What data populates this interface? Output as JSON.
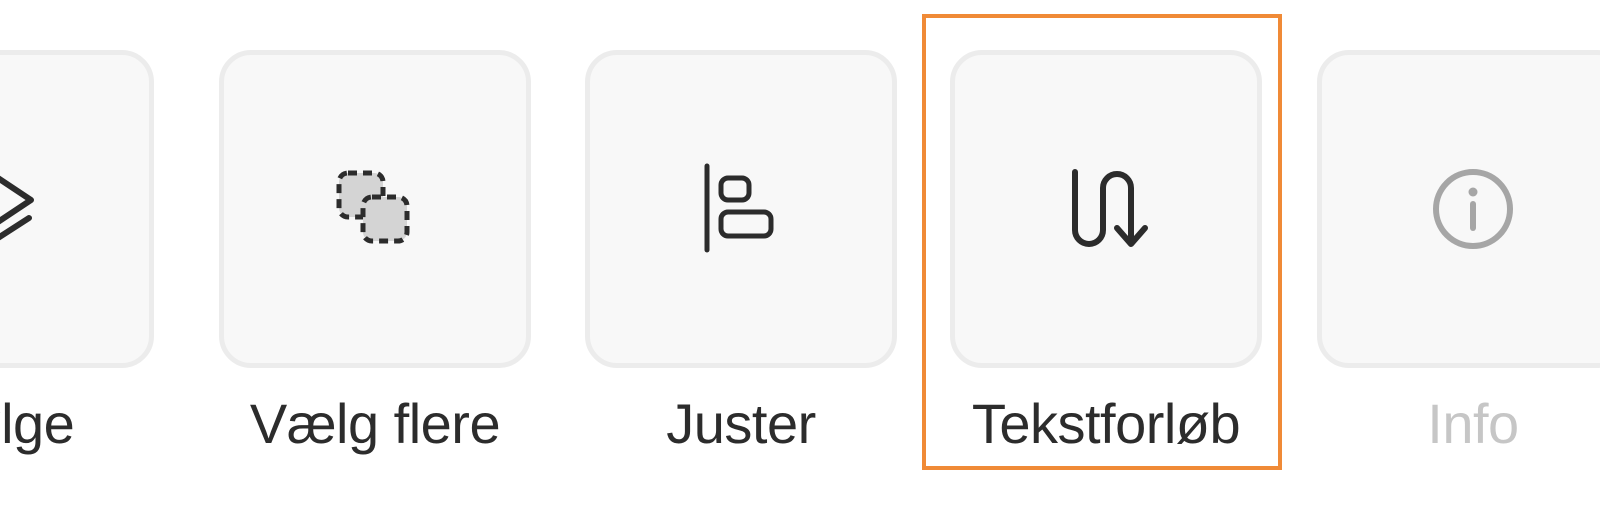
{
  "toolbar": {
    "tools": [
      {
        "id": "arrange",
        "label": "efølge",
        "icon": "layers-order-icon",
        "enabled": true
      },
      {
        "id": "multi-select",
        "label": "Vælg flere",
        "icon": "multi-select-icon",
        "enabled": true
      },
      {
        "id": "align",
        "label": "Juster",
        "icon": "align-left-icon",
        "enabled": true
      },
      {
        "id": "text-flow",
        "label": "Tekstforløb",
        "icon": "text-flow-icon",
        "enabled": true,
        "highlighted": true
      },
      {
        "id": "info",
        "label": "Info",
        "icon": "info-icon",
        "enabled": false
      }
    ]
  },
  "colors": {
    "tile_background": "#f8f8f8",
    "tile_border": "#ececec",
    "icon": "#2c2c2c",
    "icon_disabled": "#a6a6a6",
    "label": "#2c2c2c",
    "label_disabled": "#c6c6c6",
    "highlight": "#f08a36"
  }
}
